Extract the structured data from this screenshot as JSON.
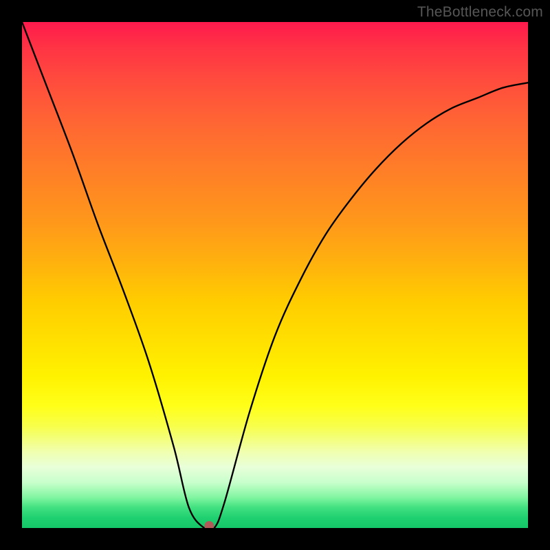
{
  "watermark": "TheBottleneck.com",
  "chart_data": {
    "type": "line",
    "title": "",
    "xlabel": "",
    "ylabel": "",
    "xlim": [
      0,
      1
    ],
    "ylim": [
      0,
      1
    ],
    "series": [
      {
        "name": "curve",
        "x": [
          0.0,
          0.05,
          0.1,
          0.15,
          0.2,
          0.25,
          0.3,
          0.33,
          0.36,
          0.38,
          0.4,
          0.45,
          0.5,
          0.55,
          0.6,
          0.65,
          0.7,
          0.75,
          0.8,
          0.85,
          0.9,
          0.95,
          1.0
        ],
        "values": [
          1.0,
          0.87,
          0.74,
          0.6,
          0.47,
          0.33,
          0.16,
          0.04,
          0.0,
          0.0,
          0.05,
          0.23,
          0.38,
          0.49,
          0.58,
          0.65,
          0.71,
          0.76,
          0.8,
          0.83,
          0.85,
          0.87,
          0.88
        ]
      }
    ],
    "marker": {
      "x": 0.37,
      "y": 0.0,
      "color": "#b15a5a"
    },
    "gradient_stops": [
      {
        "pos": 0.0,
        "color": "#ff1a4d"
      },
      {
        "pos": 0.55,
        "color": "#ffcc00"
      },
      {
        "pos": 0.85,
        "color": "#f0ffb0"
      },
      {
        "pos": 1.0,
        "color": "#15c768"
      }
    ]
  }
}
